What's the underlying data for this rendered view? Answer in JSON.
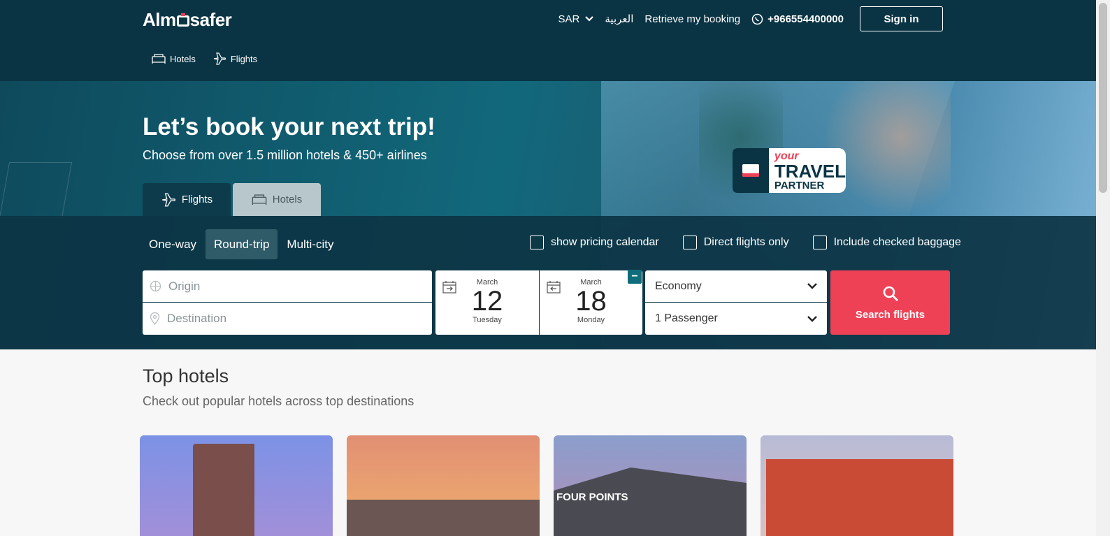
{
  "header": {
    "logo": "Almosafer",
    "currency": "SAR",
    "language": "العربية",
    "retrieve": "Retrieve my booking",
    "phone": "+966554400000",
    "signin": "Sign in"
  },
  "subnav": [
    {
      "label": "Hotels",
      "icon": "bed-icon"
    },
    {
      "label": "Flights",
      "icon": "plane-icon"
    }
  ],
  "hero": {
    "title": "Let’s book your next trip!",
    "subtitle": "Choose from over 1.5 million hotels & 450+ airlines",
    "tag": {
      "line1": "your",
      "line2": "TRAVEL",
      "line3": "PARTNER"
    }
  },
  "product_tabs": [
    {
      "label": "Flights",
      "active": true
    },
    {
      "label": "Hotels",
      "active": false
    }
  ],
  "search": {
    "trip_types": [
      "One-way",
      "Round-trip",
      "Multi-city"
    ],
    "selected_trip": "Round-trip",
    "options": [
      "show pricing calendar",
      "Direct flights only",
      "Include checked baggage"
    ],
    "origin_placeholder": "Origin",
    "destination_placeholder": "Destination",
    "depart": {
      "month": "March",
      "day": "12",
      "weekday": "Tuesday"
    },
    "return": {
      "month": "March",
      "day": "18",
      "weekday": "Monday"
    },
    "cabin": "Economy",
    "passengers": "1 Passenger",
    "button": "Search flights"
  },
  "top_hotels": {
    "title": "Top hotels",
    "subtitle": "Check out popular hotels across top destinations",
    "card3_label": "FOUR POINTS"
  },
  "colors": {
    "navy": "#0a3444",
    "accent": "#ef4156",
    "teal": "#0f6d7b"
  }
}
